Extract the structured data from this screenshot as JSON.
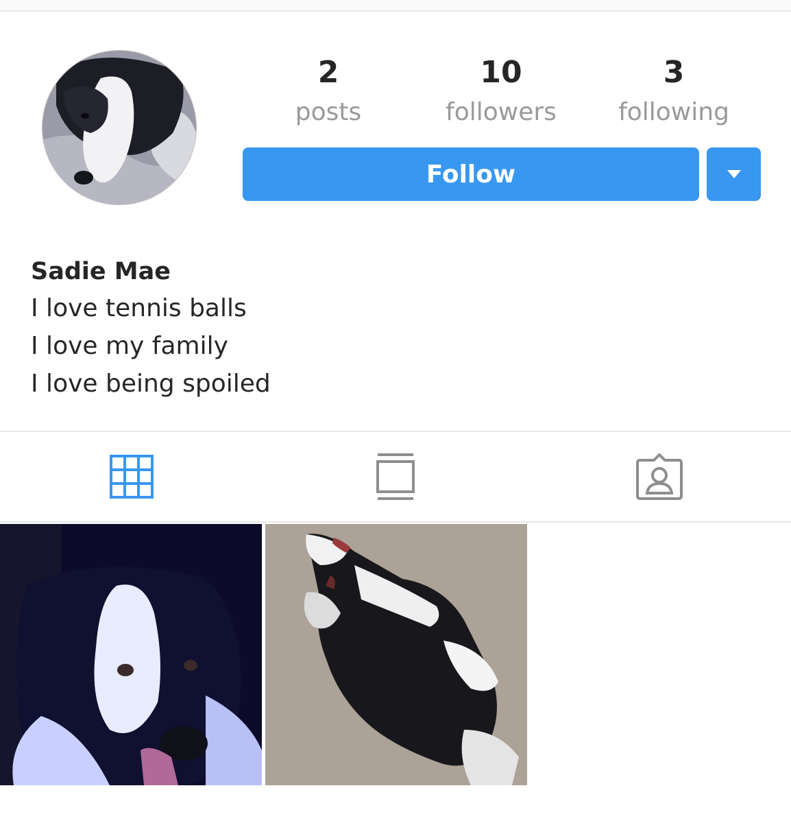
{
  "profile": {
    "name": "Sadie Mae",
    "bio_lines": [
      "I love tennis balls",
      "I love my family",
      "I love being spoiled"
    ]
  },
  "stats": {
    "posts": {
      "count": "2",
      "label": "posts"
    },
    "followers": {
      "count": "10",
      "label": "followers"
    },
    "following": {
      "count": "3",
      "label": "following"
    }
  },
  "actions": {
    "follow_label": "Follow",
    "dropdown_icon": "caret-down-icon"
  },
  "tabs": [
    {
      "icon": "grid-icon",
      "active": true
    },
    {
      "icon": "feed-icon",
      "active": false
    },
    {
      "icon": "tagged-icon",
      "active": false
    }
  ],
  "colors": {
    "accent": "#3897f0",
    "text": "#262626",
    "muted": "#999999",
    "icon_inactive": "#8e8e8e"
  },
  "posts": [
    {
      "alt": ""
    },
    {
      "alt": ""
    }
  ]
}
